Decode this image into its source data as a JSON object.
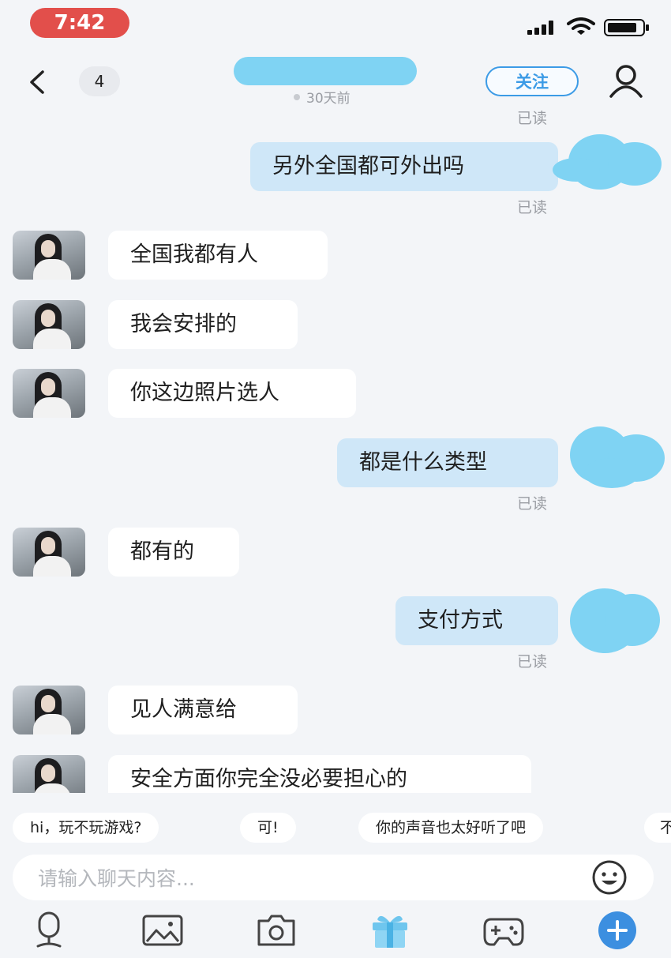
{
  "status_bar": {
    "time": "7:42"
  },
  "header": {
    "unread_count": "4",
    "follow_label": "关注",
    "last_active": "30天前"
  },
  "read_receipt": "已读",
  "messages": [
    {
      "from": "me",
      "text": "另外全国都可外出吗"
    },
    {
      "from": "them",
      "text": "全国我都有人"
    },
    {
      "from": "them",
      "text": "我会安排的"
    },
    {
      "from": "them",
      "text": "你这边照片选人"
    },
    {
      "from": "me",
      "text": "都是什么类型"
    },
    {
      "from": "them",
      "text": "都有的"
    },
    {
      "from": "me",
      "text": "支付方式"
    },
    {
      "from": "them",
      "text": "见人满意给"
    },
    {
      "from": "them",
      "text": "安全方面你完全没必要担心的"
    }
  ],
  "quick_replies": [
    "hi，玩不玩游戏?",
    "可!",
    "你的声音也太好听了吧",
    "不"
  ],
  "composer": {
    "placeholder": "请输入聊天内容..."
  },
  "toolbar": [
    "voice-icon",
    "image-icon",
    "camera-icon",
    "gift-icon",
    "game-icon",
    "plus-icon"
  ],
  "colors": {
    "accent": "#3c9be6",
    "outgoing_bubble": "#cfe7f8",
    "time_pill": "#e24f4b",
    "gift": "#6fc6ee"
  }
}
